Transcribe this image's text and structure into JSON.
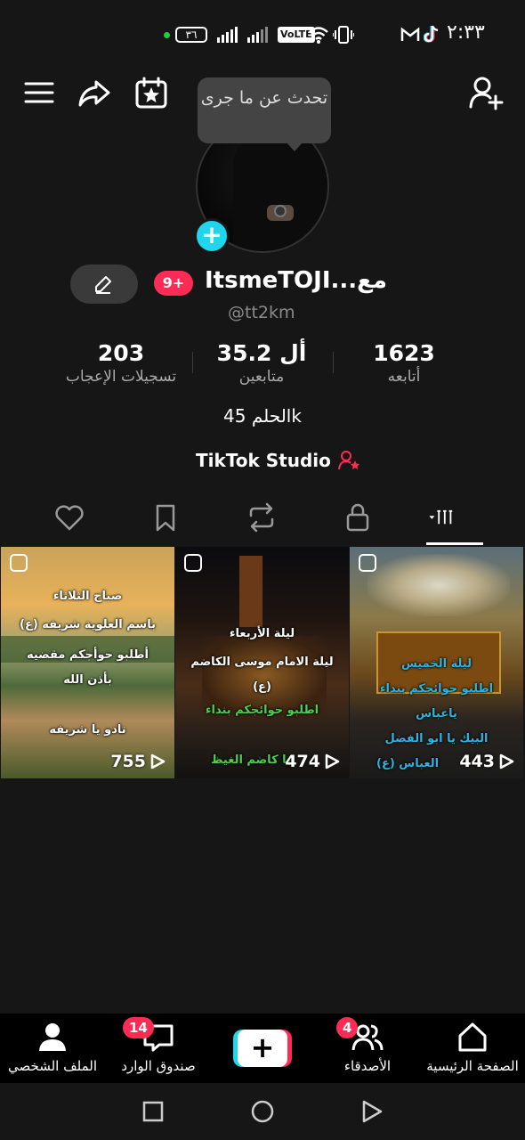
{
  "status_bar": {
    "battery": "٣٦",
    "volte": "VoLTE",
    "time": "٢:٣٣"
  },
  "header": {
    "tooltip": "تحدث عن ما جرى"
  },
  "profile": {
    "notification_badge": "9+",
    "name": "ItsmeTOJI...مع",
    "handle": "@tt2km",
    "stats": [
      {
        "value": "1623",
        "label": "أتابعه"
      },
      {
        "value": "35.2 أل",
        "label": "متابعين"
      },
      {
        "value": "203",
        "label": "تسجيلات الإعجاب"
      }
    ],
    "bio": "الحلم 45k",
    "studio_label": "TikTok Studio"
  },
  "videos": [
    {
      "lines": [
        "ليلة الخميس",
        "اطلبو حوائجكم بنداء",
        "ياعباس",
        "البيك يا ابو الفضل",
        "العباس (ع)"
      ],
      "views": "443"
    },
    {
      "lines": [
        "ليلة الأربعاء",
        "ليلة الامام موسى الكاضم",
        "(ع)",
        "اطلبو حوائجكم بنداء",
        "يا كاضم الغيظ"
      ],
      "views": "474"
    },
    {
      "lines": [
        "صباح الثلاثاء",
        "باسم العلوية شريفه (ع)",
        "أطلبو حوأجكم مقضيه",
        "بأذن الله",
        "نادو يا شريفه"
      ],
      "views": "755"
    }
  ],
  "bottom_nav": {
    "home": "الصفحة الرئيسية",
    "friends": "الأصدقاء",
    "friends_badge": "4",
    "inbox": "صندوق الوارد",
    "inbox_badge": "14",
    "profile": "الملف الشخصي"
  }
}
